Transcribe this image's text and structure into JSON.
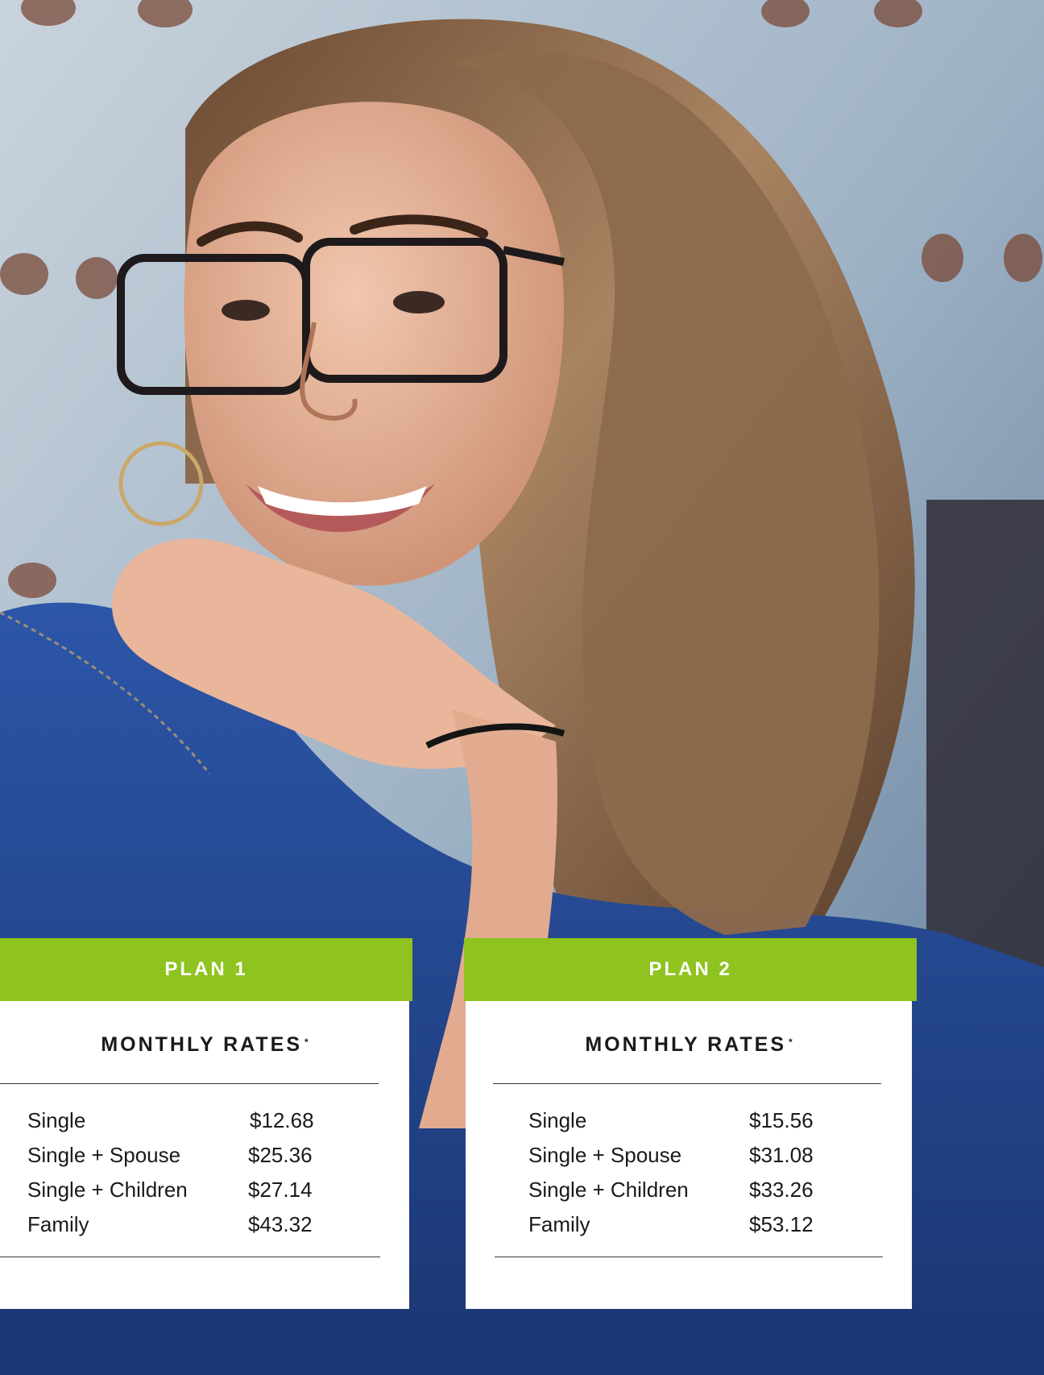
{
  "plans": [
    {
      "header": "PLAN 1",
      "rates_title": "MONTHLY RATES",
      "rates_title_mark": "*",
      "rates": [
        {
          "tier": "Single",
          "price": "$12.68"
        },
        {
          "tier": "Single + Spouse",
          "price": "$25.36"
        },
        {
          "tier": "Single + Children",
          "price": "$27.14"
        },
        {
          "tier": "Family",
          "price": "$43.32"
        }
      ]
    },
    {
      "header": "PLAN 2",
      "rates_title": "MONTHLY RATES",
      "rates_title_mark": "*",
      "rates": [
        {
          "tier": "Single",
          "price": "$15.56"
        },
        {
          "tier": "Single + Spouse",
          "price": "$31.08"
        },
        {
          "tier": "Single + Children",
          "price": "$33.26"
        },
        {
          "tier": "Family",
          "price": "$53.12"
        }
      ]
    }
  ],
  "colors": {
    "header_green": "#8fc31f",
    "card_white": "#ffffff",
    "text_dark": "#1a1a1a"
  }
}
